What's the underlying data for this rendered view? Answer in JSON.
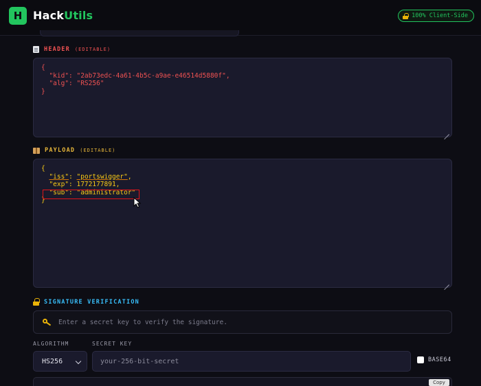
{
  "app": {
    "logo_letter": "H",
    "brand_prefix": "Hack",
    "brand_suffix": "Utils",
    "badge": "100% Client-Side"
  },
  "header_section": {
    "label": "HEADER",
    "sublabel": "(EDITABLE)",
    "lines": [
      "{",
      "  \"kid\": \"2ab73edc-4a61-4b5c-a9ae-e46514d5880f\",",
      "  \"alg\": \"RS256\"",
      "}"
    ]
  },
  "payload_section": {
    "label": "PAYLOAD",
    "sublabel": "(EDITABLE)",
    "line_open": "{",
    "iss_key": "\"iss\"",
    "iss_value": "\"portswigger\"",
    "exp_line": "  \"exp\": 1772177891,",
    "sub_line": "  \"sub\": \"administrator\"",
    "line_close": "}"
  },
  "signature": {
    "label": "SIGNATURE VERIFICATION",
    "prompt": "Enter a secret key to verify the signature.",
    "algorithm_label": "ALGORITHM",
    "algorithm_value": "HS256",
    "secret_label": "SECRET KEY",
    "secret_placeholder": "your-256-bit-secret",
    "base64_label": "BASE64",
    "copy_label": "Copy"
  },
  "icons": {
    "logo": "logo-icon",
    "badge": "lock-icon",
    "header": "document-icon",
    "payload": "package-icon",
    "signature": "lock-icon",
    "prompt": "key-icon",
    "select": "chevron-down-icon"
  },
  "colors": {
    "accent": "#22c55e",
    "header_json": "#f05252",
    "payload_json": "#facc15",
    "signature_label": "#38bdf8",
    "highlight": "#e0151a"
  }
}
